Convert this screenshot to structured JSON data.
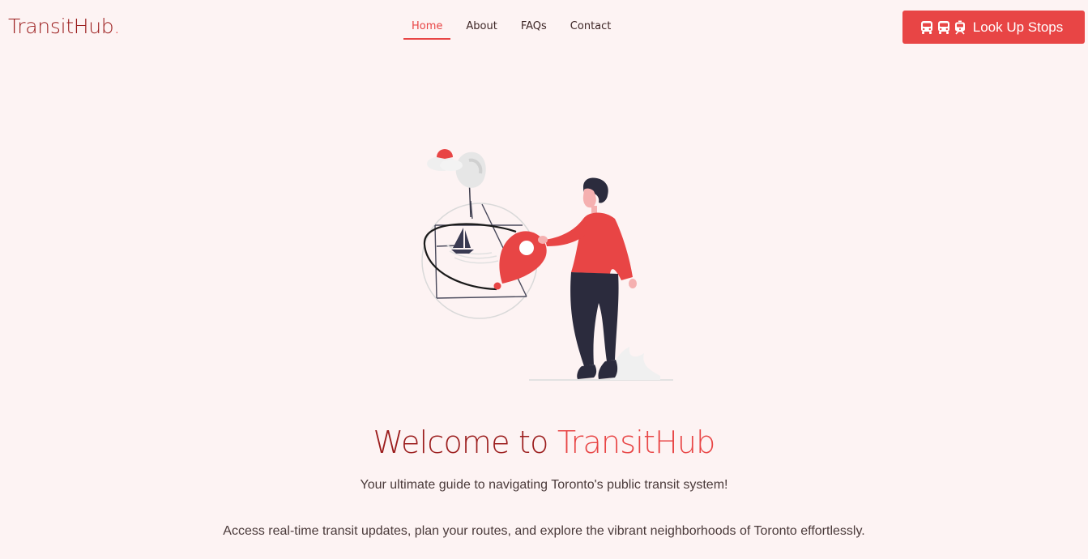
{
  "brand": {
    "name": "TransitHub",
    "dot": "."
  },
  "nav": {
    "links": [
      {
        "label": "Home",
        "active": true
      },
      {
        "label": "About",
        "active": false
      },
      {
        "label": "FAQs",
        "active": false
      },
      {
        "label": "Contact",
        "active": false
      }
    ]
  },
  "cta": {
    "label": "Look Up Stops",
    "icons": [
      "bus-icon",
      "bus-icon",
      "tram-icon"
    ]
  },
  "hero": {
    "title_prefix": "Welcome to",
    "title_accent": "TransitHub",
    "subtitle": "Your ultimate guide to navigating Toronto's public transit system!",
    "description": "Access real-time transit updates, plan your routes, and explore the vibrant neighborhoods of Toronto effortlessly."
  },
  "colors": {
    "background": "#fdf3f3",
    "accent": "#e84545",
    "brand_dark": "#9b1c1c",
    "text": "#4a3a3a"
  }
}
